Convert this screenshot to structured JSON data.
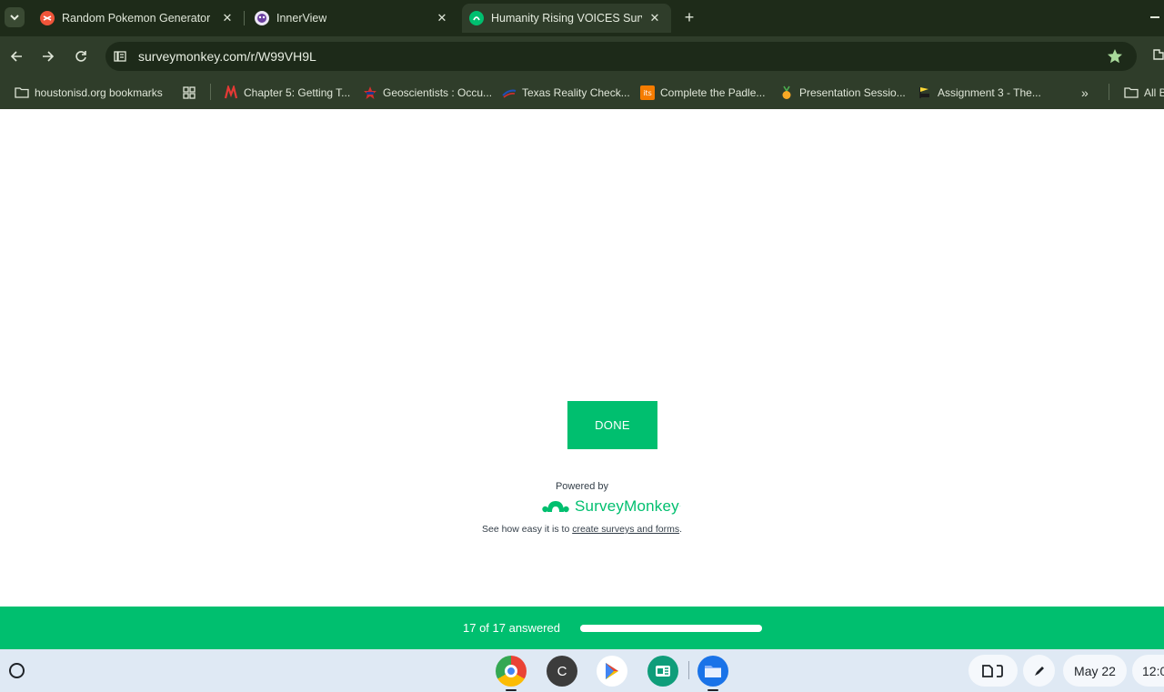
{
  "tabs": [
    {
      "title": "Random Pokemon Generator",
      "active": false
    },
    {
      "title": "InnerView",
      "active": false
    },
    {
      "title": "Humanity Rising VOICES Surve",
      "active": true
    }
  ],
  "toolbar": {
    "url": "surveymonkey.com/r/W99VH9L"
  },
  "bookmarks": [
    {
      "label": "houstonisd.org bookmarks",
      "icon": "folder-icon"
    },
    {
      "label": "Chapter 5: Getting T...",
      "icon": "red-logo-icon"
    },
    {
      "label": "Geoscientists : Occu...",
      "icon": "star-flag-icon"
    },
    {
      "label": "Texas Reality Check...",
      "icon": "swoosh-icon"
    },
    {
      "label": "Complete the Padle...",
      "icon": "orange-badge-icon"
    },
    {
      "label": "Presentation Sessio...",
      "icon": "medal-icon"
    },
    {
      "label": "Assignment 3 - The...",
      "icon": "flag-icon"
    },
    {
      "label": "All B",
      "icon": "folder-icon"
    }
  ],
  "page": {
    "done_label": "DONE",
    "powered_by": "Powered by",
    "brand": "SurveyMonkey",
    "tagline_prefix": "See how easy it is to ",
    "tagline_link": "create surveys and forms",
    "tagline_suffix": "."
  },
  "progress": {
    "text": "17 of 17 answered",
    "fraction": 1.0
  },
  "shelf": {
    "chrome_letter": "C",
    "date": "May 22",
    "time": "12:0"
  },
  "colors": {
    "accent": "#00bf6f",
    "tabstrip": "#1e2b19",
    "toolbar": "#2f3d2a"
  }
}
